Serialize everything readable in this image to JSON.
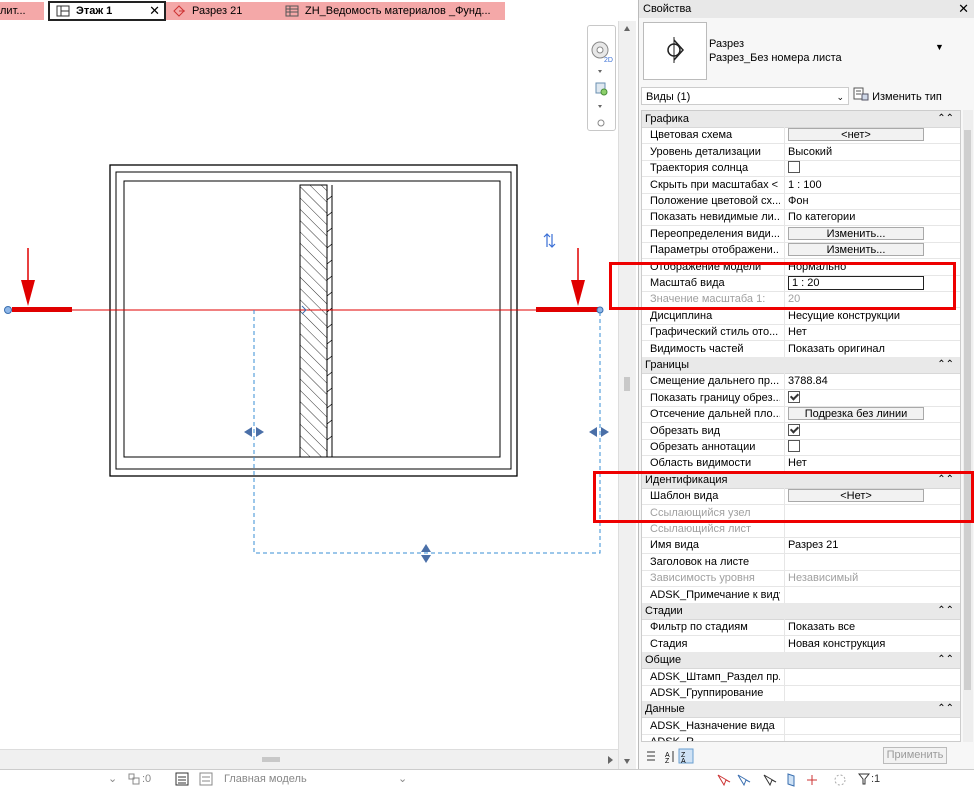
{
  "tabs": [
    {
      "label": "лит...",
      "state": "pink"
    },
    {
      "label": "Этаж 1",
      "state": "active",
      "close": "✕"
    },
    {
      "label": "Разрез 21",
      "state": "pink"
    },
    {
      "label": "ZH_Ведомость материалов _Фунд...",
      "state": "pink"
    }
  ],
  "nav": {
    "badge_2d": "2D"
  },
  "properties": {
    "title": "Свойства",
    "close": "✕",
    "type_family": "Разрез",
    "type_name": "Разрез_Без номера листа",
    "selector": "Виды (1)",
    "edit_type": "Изменить тип",
    "apply": "Применить",
    "groups": [
      {
        "name": "Графика",
        "rows": [
          {
            "k": "Цветовая схема",
            "v": "<нет>",
            "kind": "button"
          },
          {
            "k": "Уровень детализации",
            "v": "Высокий"
          },
          {
            "k": "Траектория солнца",
            "v": "",
            "kind": "checkbox",
            "checked": false
          },
          {
            "k": "Скрыть при масштабах <",
            "v": "1 : 100"
          },
          {
            "k": "Положение цветовой сх...",
            "v": "Фон"
          },
          {
            "k": "Показать невидимые ли...",
            "v": "По категории"
          },
          {
            "k": "Переопределения види...",
            "v": "Изменить...",
            "kind": "button"
          },
          {
            "k": "Параметры отображени...",
            "v": "Изменить...",
            "kind": "button"
          },
          {
            "k": "Отображение модели",
            "v": "Нормально"
          },
          {
            "k": "Масштаб вида",
            "v": "1 : 20",
            "kind": "input"
          },
          {
            "k": "Значение масштаба   1:",
            "v": "20",
            "disabled": true
          },
          {
            "k": "Дисциплина",
            "v": "Несущие конструкции"
          },
          {
            "k": "Графический стиль ото...",
            "v": "Нет"
          },
          {
            "k": "Видимость частей",
            "v": "Показать оригинал"
          }
        ]
      },
      {
        "name": "Границы",
        "rows": [
          {
            "k": "Смещение дальнего пр...",
            "v": "3788.84"
          },
          {
            "k": "Показать границу обрез...",
            "v": "",
            "kind": "checkbox",
            "checked": true
          },
          {
            "k": "Отсечение дальней пло...",
            "v": "Подрезка без линии",
            "kind": "button"
          },
          {
            "k": "Обрезать вид",
            "v": "",
            "kind": "checkbox",
            "checked": true
          },
          {
            "k": "Обрезать аннотации",
            "v": "",
            "kind": "checkbox",
            "checked": false
          },
          {
            "k": "Область видимости",
            "v": "Нет"
          }
        ]
      },
      {
        "name": "Идентификация",
        "rows": [
          {
            "k": "Шаблон вида",
            "v": "<Нет>",
            "kind": "button"
          },
          {
            "k": "Ссылающийся узел",
            "v": "",
            "disabled": true
          },
          {
            "k": "Ссылающийся лист",
            "v": "",
            "disabled": true
          },
          {
            "k": "Имя вида",
            "v": "Разрез 21"
          },
          {
            "k": "Заголовок на листе",
            "v": ""
          },
          {
            "k": "Зависимость уровня",
            "v": "Независимый",
            "disabled": true
          },
          {
            "k": "ADSK_Примечание к виду",
            "v": ""
          }
        ]
      },
      {
        "name": "Стадии",
        "rows": [
          {
            "k": "Фильтр по стадиям",
            "v": "Показать все"
          },
          {
            "k": "Стадия",
            "v": "Новая конструкция"
          }
        ]
      },
      {
        "name": "Общие",
        "rows": [
          {
            "k": "ADSK_Штамп_Раздел пр...",
            "v": ""
          },
          {
            "k": "ADSK_Группирование",
            "v": ""
          }
        ]
      },
      {
        "name": "Данные",
        "rows": [
          {
            "k": "ADSK_Назначение вида",
            "v": ""
          },
          {
            "k": "ADSK_R...",
            "v": ""
          }
        ]
      }
    ]
  },
  "status": {
    "selection_count": ":0",
    "workset": "Главная модель",
    "filter_count": ":1"
  },
  "colors": {
    "accent_red": "#e00000",
    "crop_blue": "#3a8fd6",
    "tab_pink": "#f4a8a8"
  }
}
